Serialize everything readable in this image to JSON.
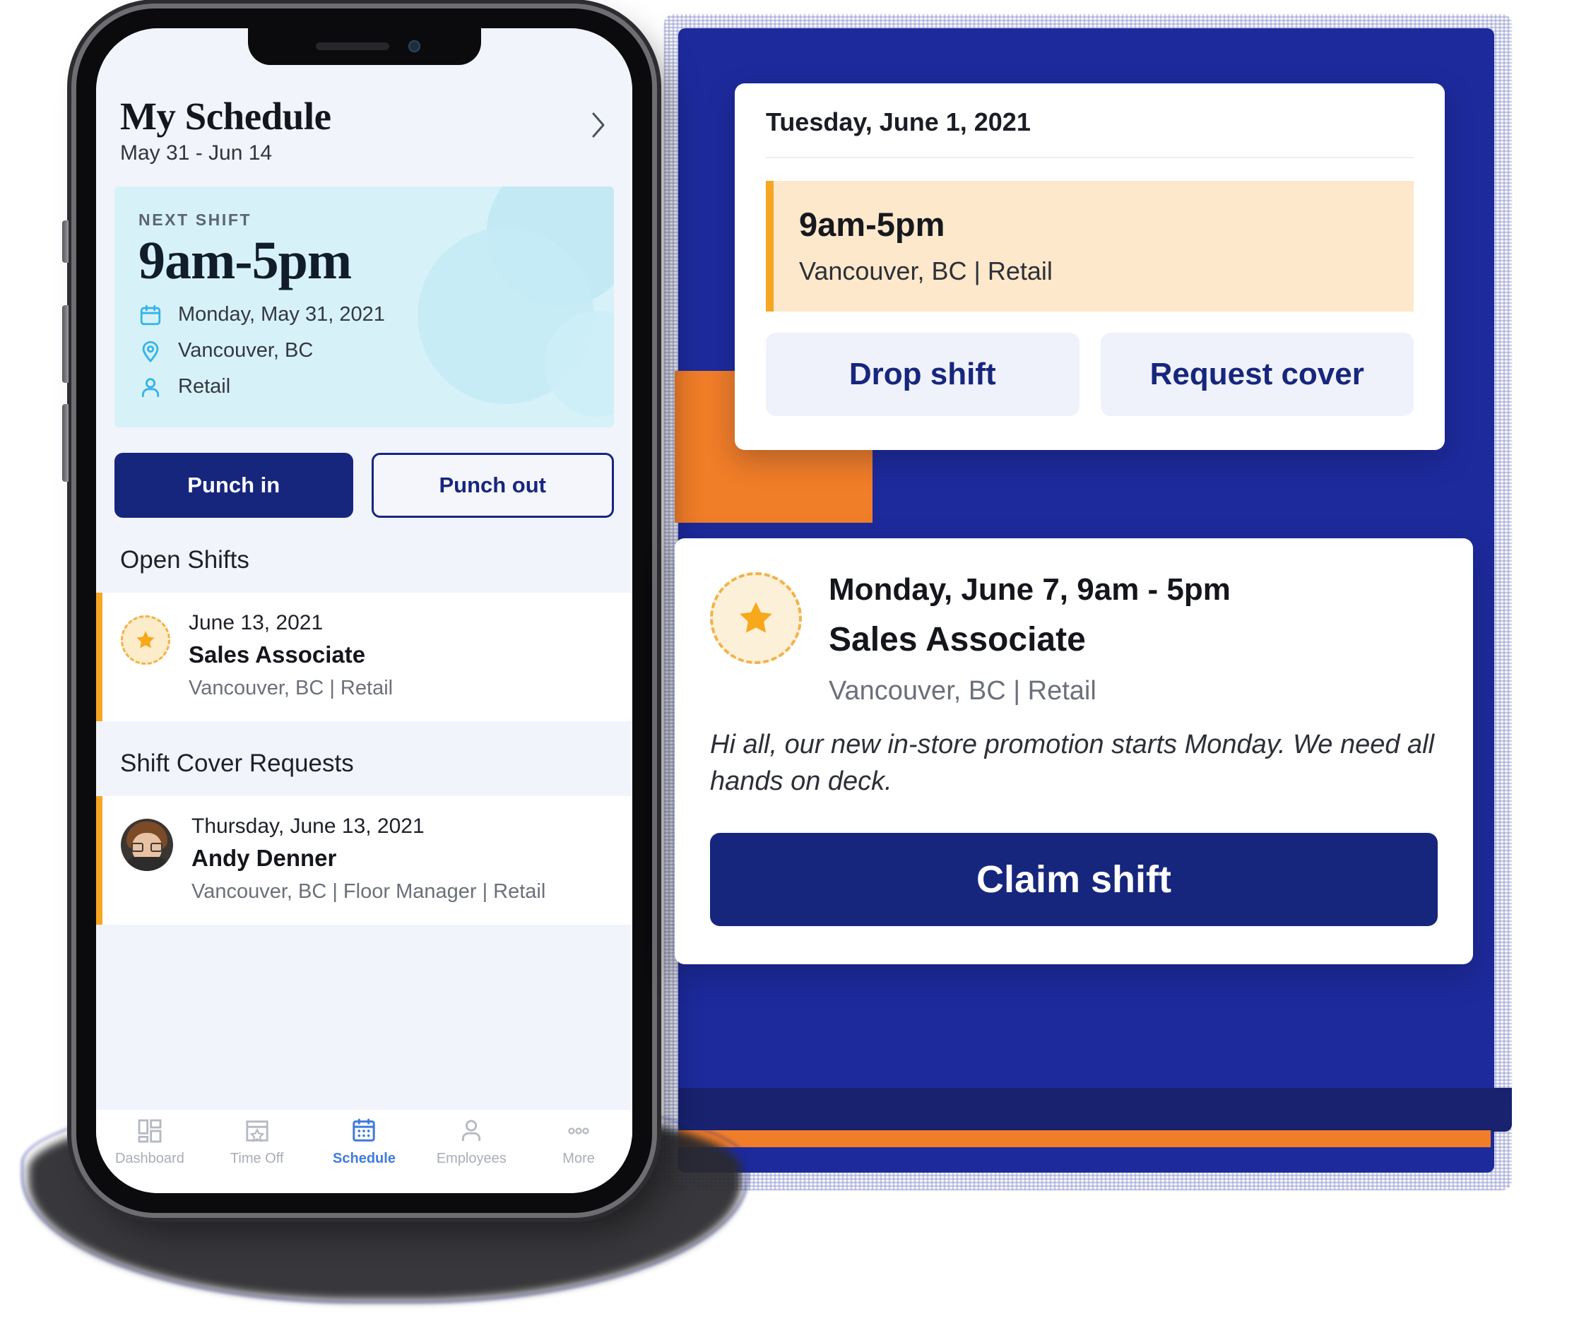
{
  "phone": {
    "header": {
      "title": "My Schedule",
      "date_range": "May 31 - Jun 14",
      "chevron_icon": "chevron-right-icon"
    },
    "next_shift": {
      "label": "NEXT SHIFT",
      "time": "9am-5pm",
      "date": "Monday, May 31, 2021",
      "location": "Vancouver, BC",
      "department": "Retail",
      "icons": {
        "date": "calendar-icon",
        "location": "map-pin-icon",
        "department": "person-icon"
      }
    },
    "punch": {
      "in_label": "Punch in",
      "out_label": "Punch out"
    },
    "open_shifts": {
      "title": "Open Shifts",
      "items": [
        {
          "badge_icon": "star-badge-icon",
          "date": "June 13, 2021",
          "role": "Sales Associate",
          "meta": "Vancouver, BC | Retail"
        }
      ]
    },
    "shift_cover_requests": {
      "title": "Shift Cover Requests",
      "items": [
        {
          "avatar": "employee-avatar",
          "date": "Thursday, June 13, 2021",
          "name": "Andy Denner",
          "meta": "Vancouver, BC | Floor Manager | Retail"
        }
      ]
    },
    "tabbar": {
      "items": [
        {
          "label": "Dashboard",
          "icon": "dashboard-grid-icon",
          "active": false
        },
        {
          "label": "Time Off",
          "icon": "calendar-star-icon",
          "active": false
        },
        {
          "label": "Schedule",
          "icon": "calendar-dots-icon",
          "active": true
        },
        {
          "label": "Employees",
          "icon": "person-icon",
          "active": false
        },
        {
          "label": "More",
          "icon": "ellipsis-icon",
          "active": false
        }
      ]
    }
  },
  "shift_detail_card": {
    "date": "Tuesday, June 1, 2021",
    "shift": {
      "time": "9am-5pm",
      "meta": "Vancouver, BC | Retail"
    },
    "actions": {
      "drop_label": "Drop shift",
      "cover_label": "Request cover"
    }
  },
  "open_shift_card": {
    "badge_icon": "star-badge-icon",
    "when": "Monday, June 7, 9am - 5pm",
    "role": "Sales Associate",
    "location": "Vancouver, BC | Retail",
    "note": "Hi all, our new in-store promotion starts Monday. We need all hands on deck.",
    "claim_label": "Claim shift"
  },
  "colors": {
    "navy": "#17267d",
    "decor_navy": "#1d2a9c",
    "orange": "#f07d28",
    "accent_orange": "#f5a623",
    "cyan_card": "#d6f2f8",
    "icon_blue": "#35b4ea",
    "tab_active_blue": "#3f7ae0",
    "shift_strip_bg": "#fde8cb",
    "screen_bg": "#f1f4fb"
  }
}
